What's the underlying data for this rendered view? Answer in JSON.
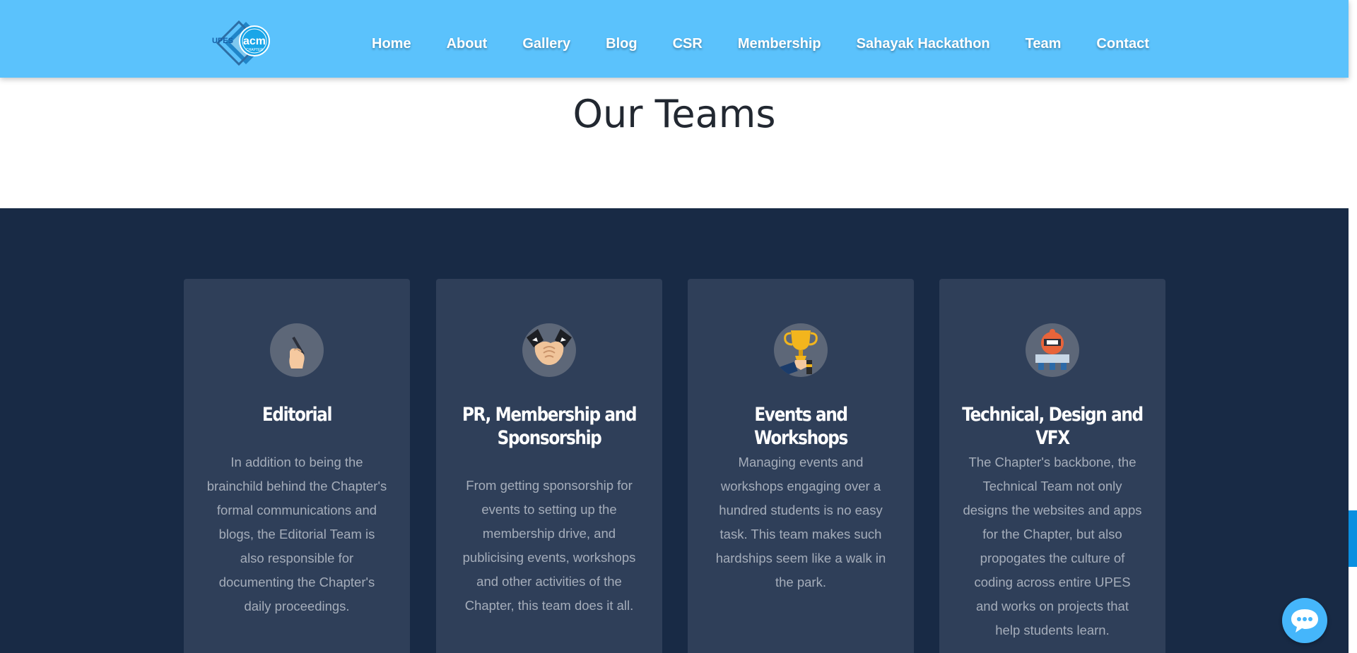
{
  "logo": {
    "text": "acm",
    "prefix": "UPES",
    "suffix": "CHAPTER"
  },
  "nav": {
    "items": [
      {
        "label": "Home"
      },
      {
        "label": "About"
      },
      {
        "label": "Gallery"
      },
      {
        "label": "Blog"
      },
      {
        "label": "CSR"
      },
      {
        "label": "Membership"
      },
      {
        "label": "Sahayak Hackathon"
      },
      {
        "label": "Team"
      },
      {
        "label": "Contact"
      }
    ]
  },
  "hero": {
    "title": "Our Teams"
  },
  "teams": [
    {
      "icon": "hand-writing-icon",
      "title": "Editorial",
      "lines": [
        "In addition to being the",
        "brainchild behind the Chapter's",
        "formal communications and",
        "blogs,  the Editorial Team is",
        "also responsible for",
        "documenting the Chapter's",
        "daily proceedings."
      ]
    },
    {
      "icon": "handshake-icon",
      "title_lines": [
        "PR, Membership and",
        "Sponsorship"
      ],
      "lines": [
        "From getting sponsorship for",
        "events to setting up the",
        "membership drive,  and",
        "publicising events,  workshops",
        "and other activities of the",
        "Chapter,  this team does it all."
      ]
    },
    {
      "icon": "trophy-icon",
      "title": "Events and Workshops",
      "lines": [
        "Managing events and",
        "workshops engaging over a",
        "hundred students is no easy",
        "task. This team makes such",
        "hardships seem like a walk in",
        "the park."
      ]
    },
    {
      "icon": "robot-coder-icon",
      "title": "Technical, Design and VFX",
      "lines": [
        "The Chapter's backbone,  the",
        "Technical Team not only",
        "designs the websites and apps",
        "for the Chapter,  but also",
        "propogates the culture of",
        "coding across entire UPES",
        "and works on projects that",
        "help students learn."
      ]
    }
  ],
  "colors": {
    "nav": "#5bc2fc",
    "section": "#182a45",
    "card": "#2f3f59",
    "chat": "#45b6fb"
  },
  "chat": {
    "icon": "chat-bubble-icon"
  }
}
